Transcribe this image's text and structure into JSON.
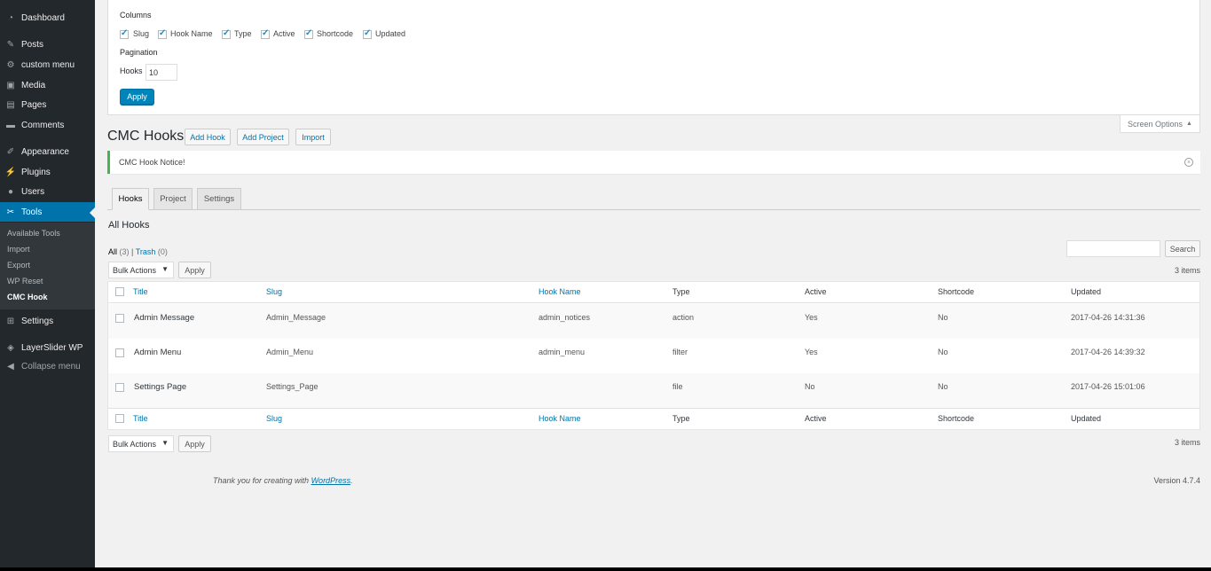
{
  "sidebar": {
    "items": [
      {
        "label": "Dashboard",
        "icon": "dashboard-icon"
      },
      {
        "label": "Posts",
        "icon": "pin-icon"
      },
      {
        "label": "custom menu",
        "icon": "gear-icon"
      },
      {
        "label": "Media",
        "icon": "media-icon"
      },
      {
        "label": "Pages",
        "icon": "page-icon"
      },
      {
        "label": "Comments",
        "icon": "comment-icon"
      },
      {
        "label": "Appearance",
        "icon": "brush-icon"
      },
      {
        "label": "Plugins",
        "icon": "plug-icon"
      },
      {
        "label": "Users",
        "icon": "user-icon"
      },
      {
        "label": "Tools",
        "icon": "wrench-icon"
      },
      {
        "label": "Settings",
        "icon": "settings-icon"
      },
      {
        "label": "LayerSlider WP",
        "icon": "layers-icon"
      },
      {
        "label": "Collapse menu",
        "icon": "collapse-icon"
      }
    ],
    "submenu": [
      "Available Tools",
      "Import",
      "Export",
      "WP Reset",
      "CMC Hook"
    ]
  },
  "screen_options": {
    "columns_label": "Columns",
    "columns": [
      "Slug",
      "Hook Name",
      "Type",
      "Active",
      "Shortcode",
      "Updated"
    ],
    "pagination_label": "Pagination",
    "hooks_label": "Hooks",
    "hooks_value": "10",
    "apply_label": "Apply",
    "toggle_label": "Screen Options",
    "toggle_arrow": "▲"
  },
  "header": {
    "title": "CMC Hooks",
    "add_hook": "Add Hook",
    "add_project": "Add Project",
    "import": "Import"
  },
  "notice": {
    "text": "CMC Hook Notice!",
    "dismiss": "×"
  },
  "tabs": [
    "Hooks",
    "Project",
    "Settings"
  ],
  "section_title": "All Hooks",
  "views": {
    "all_label": "All",
    "all_count": "(3)",
    "separator": "|",
    "trash_label": "Trash",
    "trash_count": "(0)"
  },
  "search": {
    "button": "Search"
  },
  "bulk": {
    "select_label": "Bulk Actions",
    "arrow": "▼",
    "apply_label": "Apply",
    "items_count": "3 items"
  },
  "table": {
    "headers": [
      "Title",
      "Slug",
      "Hook Name",
      "Type",
      "Active",
      "Shortcode",
      "Updated"
    ],
    "rows": [
      {
        "title": "Admin Message",
        "slug": "Admin_Message",
        "hook_name": "admin_notices",
        "type": "action",
        "active": "Yes",
        "shortcode": "No",
        "updated": "2017-04-26 14:31:36"
      },
      {
        "title": "Admin Menu",
        "slug": "Admin_Menu",
        "hook_name": "admin_menu",
        "type": "filter",
        "active": "Yes",
        "shortcode": "No",
        "updated": "2017-04-26 14:39:32"
      },
      {
        "title": "Settings Page",
        "slug": "Settings_Page",
        "hook_name": "",
        "type": "file",
        "active": "No",
        "shortcode": "No",
        "updated": "2017-04-26 15:01:06"
      }
    ]
  },
  "footer": {
    "thanks_prefix": "Thank you for creating with ",
    "thanks_link": "WordPress",
    "thanks_suffix": ".",
    "version": "Version 4.7.4"
  },
  "colors": {
    "sidebar_bg": "#23282d",
    "accent": "#0073aa",
    "notice_success": "#46b450"
  }
}
